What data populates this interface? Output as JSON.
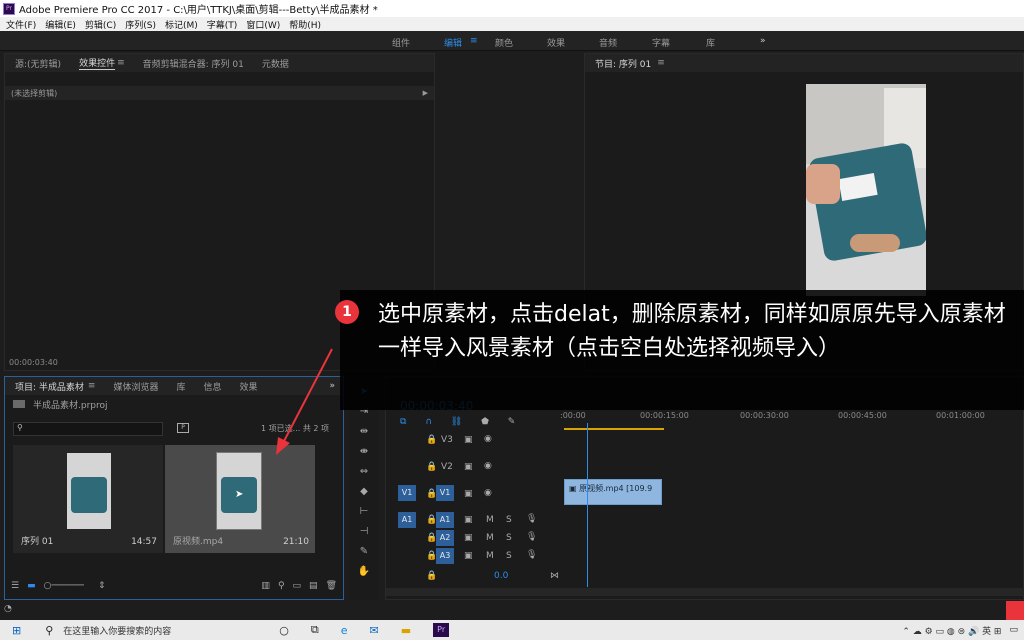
{
  "window": {
    "title": "Adobe Premiere Pro CC 2017 - C:\\用户\\TTKJ\\桌面\\剪辑---Betty\\半成品素材 *"
  },
  "menu": [
    "文件(F)",
    "编辑(E)",
    "剪辑(C)",
    "序列(S)",
    "标记(M)",
    "字幕(T)",
    "窗口(W)",
    "帮助(H)"
  ],
  "workspaces": [
    "组件",
    "编辑",
    "颜色",
    "效果",
    "音频",
    "字幕",
    "库"
  ],
  "workspace_more": "»",
  "source_panel": {
    "tabs": [
      "源:(无剪辑)",
      "效果控件",
      "音频剪辑混合器: 序列 01",
      "元数据"
    ],
    "menu_glyph": "≡",
    "subheader": "(未选择剪辑)",
    "timecode": "00:00:03:40"
  },
  "program_panel": {
    "title": "节目: 序列 01",
    "menu_glyph": "≡"
  },
  "project_panel": {
    "tabs": [
      "项目: 半成品素材",
      "媒体浏览器",
      "库",
      "信息",
      "效果"
    ],
    "menu_glyph": "≡",
    "more": "»",
    "file": "半成品素材.prproj",
    "selection": "1 项已选... 共 2 项",
    "items": [
      {
        "name": "序列 01",
        "duration": "14:57"
      },
      {
        "name": "原视频.mp4",
        "duration": "21:10"
      }
    ]
  },
  "timeline": {
    "timecode": "00:00:03:40",
    "ruler": [
      ":00:00",
      "00:00:15:00",
      "00:00:30:00",
      "00:00:45:00",
      "00:01:00:00"
    ],
    "tracks": [
      "V3",
      "V2",
      "V1",
      "A1",
      "A2",
      "A3"
    ],
    "src_v": "V1",
    "src_a": "A1",
    "clip": "原视频.mp4 [109.9",
    "volume": "0.0",
    "mute": "M",
    "solo": "S"
  },
  "callout": {
    "number": "1",
    "text": "选中原素材，点击delat，删除原素材，同样如原原先导入原素材一样导入风景素材（点击空白处选择视频导入）"
  },
  "taskbar": {
    "search_placeholder": "在这里输入你要搜索的内容",
    "pr_label": "Pr"
  }
}
